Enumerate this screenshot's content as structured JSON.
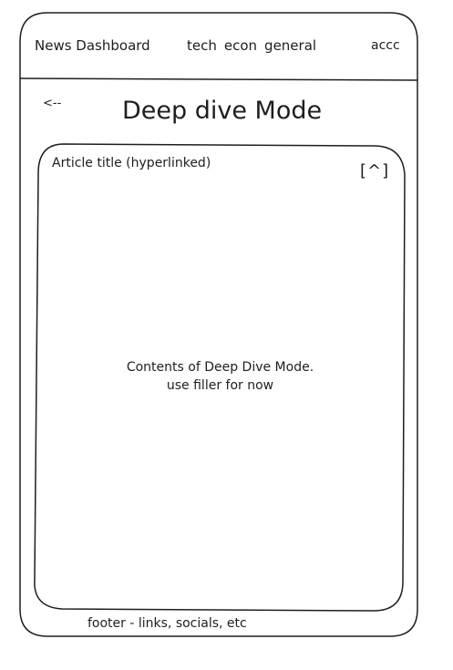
{
  "nav": {
    "brand": "News Dashboard",
    "tabs": [
      {
        "label": "tech"
      },
      {
        "label": "econ"
      },
      {
        "label": "general"
      }
    ],
    "account": "accc"
  },
  "page": {
    "back": "<--",
    "title": "Deep dive Mode"
  },
  "article": {
    "title": "Article title (hyperlinked)",
    "collapse_label": "[^]",
    "content_line1": "Contents of Deep Dive Mode.",
    "content_line2": "use filler for now"
  },
  "footer": {
    "text": "footer - links, socials, etc"
  }
}
